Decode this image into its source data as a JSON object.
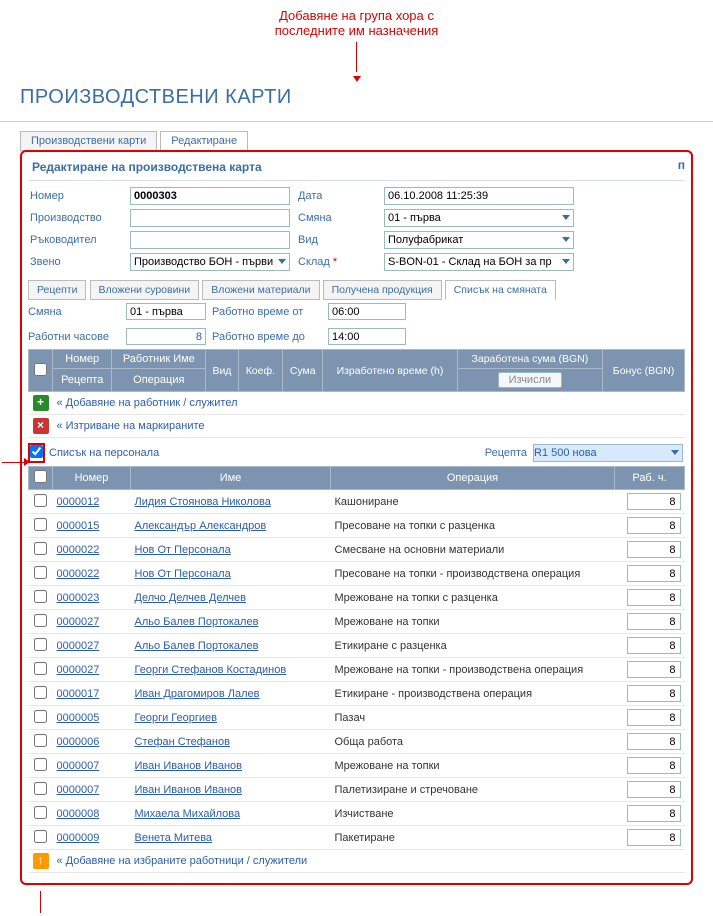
{
  "annotation_top": "Добавяне на група хора с\nпоследните им назначения",
  "page_title": "ПРОИЗВОДСТВЕНИ КАРТИ",
  "outer_tabs": {
    "cards": "Производствени карти",
    "edit": "Редактиране"
  },
  "panel_title": "Редактиране на производствена карта",
  "form": {
    "l_number": "Номер",
    "v_number": "0000303",
    "l_date": "Дата",
    "v_date": "06.10.2008 11:25:39",
    "l_prod": "Производство",
    "v_prod": "",
    "l_shift": "Смяна",
    "v_shift": "01 - първа",
    "l_manager": "Ръководител",
    "v_manager": "",
    "l_kind": "Вид",
    "v_kind": "Полуфабрикат",
    "l_unit": "Звено",
    "v_unit": "Производство БОН - първи це",
    "l_store": "Склад",
    "v_store": "S-BON-01 - Склад на БОН за пр"
  },
  "subtabs": {
    "recipes": "Рецепти",
    "raw": "Вложени суровини",
    "mat": "Вложени материали",
    "prod": "Получена продукция",
    "list": "Списък на смяната"
  },
  "shift": {
    "l_shift": "Смяна",
    "v_shift": "01 - първа",
    "l_from": "Работно време от",
    "v_from": "06:00",
    "l_hours": "Работни часове",
    "v_hours": "8",
    "l_to": "Работно време до",
    "v_to": "14:00"
  },
  "grid_head": {
    "number": "Номер",
    "name": "Работник Име",
    "kind": "Вид",
    "coef": "Коеф.",
    "sum": "Сума",
    "time": "Изработено време (h)",
    "earned": "Заработена сума (BGN)",
    "bonus": "Бонус (BGN)",
    "recipe": "Рецепта",
    "operation": "Операция",
    "btn_calc": "Изчисли"
  },
  "action_add": "« Добавяне на работник / служител",
  "action_del": "« Изтриване на маркираните",
  "personnel_title": "Списък на персонала",
  "recipe_label": "Рецепта",
  "recipe_value": "R1 500 нова",
  "p_head": {
    "number": "Номер",
    "name": "Име",
    "op": "Операция",
    "hours": "Раб. ч."
  },
  "rows": [
    {
      "num": "0000012",
      "name": "Лидия Стоянова Николова",
      "op": "Кашониране",
      "h": "8"
    },
    {
      "num": "0000015",
      "name": "Александър Александров",
      "op": "Пресоване на топки с разценка",
      "h": "8"
    },
    {
      "num": "0000022",
      "name": "Нов От Персонала",
      "op": "Смесване на основни материали",
      "h": "8"
    },
    {
      "num": "0000022",
      "name": "Нов От Персонала",
      "op": "Пресоване на топки - производствена операция",
      "h": "8"
    },
    {
      "num": "0000023",
      "name": "Делчо Делчев Делчев",
      "op": "Мрежоване на топки с разценка",
      "h": "8"
    },
    {
      "num": "0000027",
      "name": "Альо Балев Портокалев",
      "op": "Мрежоване на топки",
      "h": "8"
    },
    {
      "num": "0000027",
      "name": "Альо Балев Портокалев",
      "op": "Етикиране с разценка",
      "h": "8"
    },
    {
      "num": "0000027",
      "name": "Георги Стефанов Костадинов",
      "op": "Мрежоване на топки - производствена операция",
      "h": "8"
    },
    {
      "num": "0000017",
      "name": "Иван Драгомиров Лалев",
      "op": "Етикиране - производствена операция",
      "h": "8"
    },
    {
      "num": "0000005",
      "name": "Георги Георгиев",
      "op": "Пазач",
      "h": "8"
    },
    {
      "num": "0000006",
      "name": "Стефан Стефанов",
      "op": "Обща работа",
      "h": "8"
    },
    {
      "num": "0000007",
      "name": "Иван Иванов Иванов",
      "op": "Мрежоване на топки",
      "h": "8"
    },
    {
      "num": "0000007",
      "name": "Иван Иванов Иванов",
      "op": "Палетизиране и стречоване",
      "h": "8"
    },
    {
      "num": "0000008",
      "name": "Михаела Михайлова",
      "op": "Изчистване",
      "h": "8"
    },
    {
      "num": "0000009",
      "name": "Венета Митева",
      "op": "Пакетиране",
      "h": "8"
    }
  ],
  "action_add_selected": "« Добавяне на избраните работници / служители"
}
